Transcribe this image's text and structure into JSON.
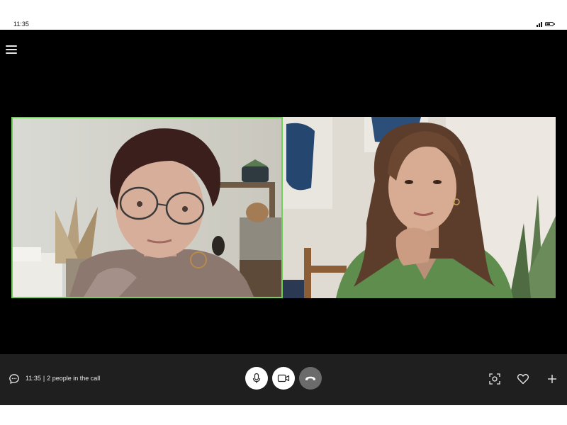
{
  "status_bar": {
    "time": "11:35",
    "icons": [
      "signal-icon",
      "battery-icon"
    ]
  },
  "call": {
    "menu_icon": "hamburger-menu-icon",
    "participants": [
      {
        "tile": "participant-video-1",
        "active_speaker": true,
        "highlight_color": "#6fd05a"
      },
      {
        "tile": "participant-video-2",
        "active_speaker": false
      }
    ]
  },
  "controls": {
    "chat_icon": "chat-bubble-icon",
    "call_time": "11:35",
    "separator": "|",
    "people_count": "2 people in the call",
    "buttons": [
      {
        "name": "mic-button",
        "icon": "microphone-icon"
      },
      {
        "name": "video-button",
        "icon": "video-camera-icon"
      },
      {
        "name": "end-call-button",
        "icon": "phone-hangup-icon"
      }
    ],
    "right_buttons": [
      {
        "name": "focus-button",
        "icon": "camera-focus-icon"
      },
      {
        "name": "favorite-button",
        "icon": "heart-icon"
      },
      {
        "name": "add-button",
        "icon": "plus-icon"
      }
    ]
  },
  "colors": {
    "call_background": "#000000",
    "control_bar": "#1f1f1f",
    "active_border": "#6fd05a",
    "end_call": "#6b6b6b"
  }
}
